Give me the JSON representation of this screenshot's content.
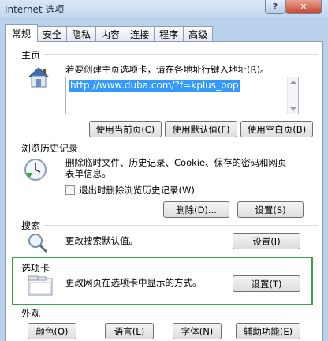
{
  "window": {
    "title": "Internet 选项",
    "help_label": "?",
    "close_label": "✕"
  },
  "tabs": [
    {
      "label": "常规",
      "active": true
    },
    {
      "label": "安全"
    },
    {
      "label": "隐私"
    },
    {
      "label": "内容"
    },
    {
      "label": "连接"
    },
    {
      "label": "程序"
    },
    {
      "label": "高级"
    }
  ],
  "home": {
    "label": "主页",
    "description": "若要创建主页选项卡，请在各地址行键入地址(R)。",
    "url": "http://www.duba.com/?f=kplus_pop",
    "use_current": "使用当前页(C)",
    "use_default": "使用默认值(F)",
    "use_blank": "使用空白页(B)"
  },
  "history": {
    "label": "浏览历史记录",
    "description_line1": "删除临时文件、历史记录、Cookie、保存的密码和网页",
    "description_line2": "表单信息。",
    "checkbox_label": "退出时删除浏览历史记录(W)",
    "delete_button": "删除(D)...",
    "settings_button": "设置(S)"
  },
  "search": {
    "label": "搜索",
    "description": "更改搜索默认值。",
    "settings_button": "设置(I)"
  },
  "tabs_section": {
    "label": "选项卡",
    "description": "更改网页在选项卡中显示的方式。",
    "settings_button": "设置(T)"
  },
  "appearance": {
    "label": "外观",
    "colors": "颜色(O)",
    "languages": "语言(L)",
    "fonts": "字体(N)",
    "accessibility": "辅助功能(E)"
  }
}
